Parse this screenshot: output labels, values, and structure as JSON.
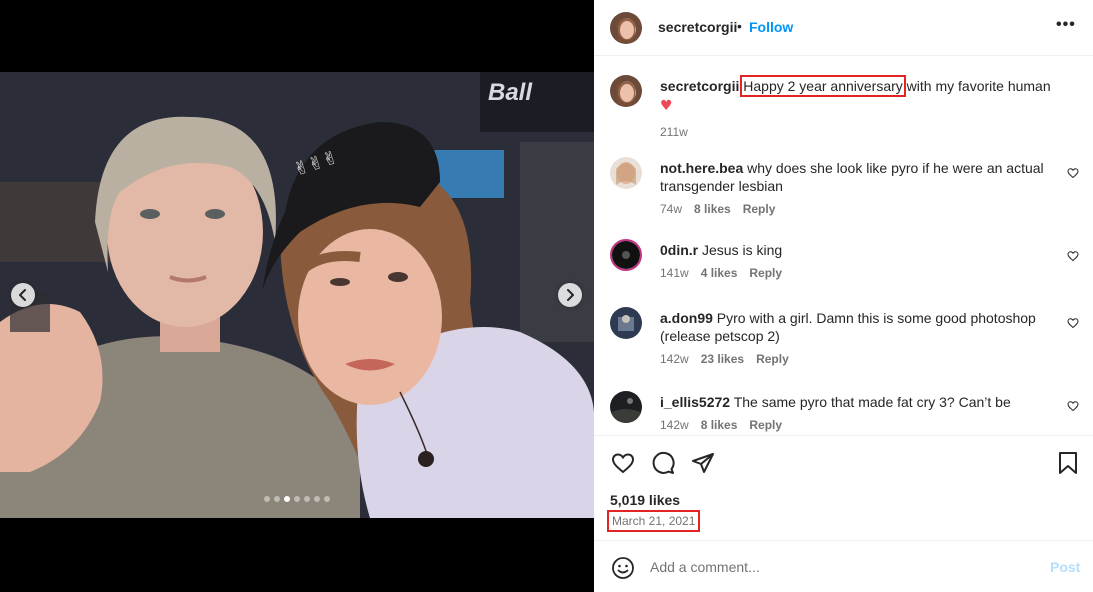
{
  "post": {
    "author": "secretcorgii",
    "separator": "•",
    "follow_label": "Follow",
    "more_label": "•••",
    "carousel": {
      "slide_count": 7,
      "active_slide": 3
    },
    "caption": {
      "username": "secretcorgii",
      "highlighted_text": "Happy 2 year anniversary",
      "rest_text": " with my favorite human",
      "emoji": "❤️",
      "time": "211w"
    },
    "comments": [
      {
        "username": "not.here.bea",
        "text": "why does she look like pyro if he were an actual transgender lesbian",
        "time": "74w",
        "likes": "8 likes",
        "reply": "Reply"
      },
      {
        "username": "0din.r",
        "text": "Jesus is king",
        "time": "141w",
        "likes": "4 likes",
        "reply": "Reply"
      },
      {
        "username": "a.don99",
        "text": "Pyro with a girl. Damn this is some good photoshop (release petscop 2)",
        "time": "142w",
        "likes": "23 likes",
        "reply": "Reply"
      },
      {
        "username": "i_ellis5272",
        "text": "The same pyro that made fat cry 3? Can’t be",
        "time": "142w",
        "likes": "8 likes",
        "reply": "Reply"
      }
    ],
    "likes_count": "5,019 likes",
    "date": "March 21, 2021",
    "add_comment_placeholder": "Add a comment...",
    "post_button": "Post"
  },
  "colors": {
    "accent": "#0095f6",
    "highlight_box": "#e32424",
    "like_red": "#ed4956",
    "muted": "#737373"
  },
  "icons": [
    "prev-arrow-icon",
    "next-arrow-icon",
    "more-options-icon",
    "heart-icon",
    "comment-icon",
    "share-icon",
    "save-icon",
    "emoji-icon"
  ]
}
